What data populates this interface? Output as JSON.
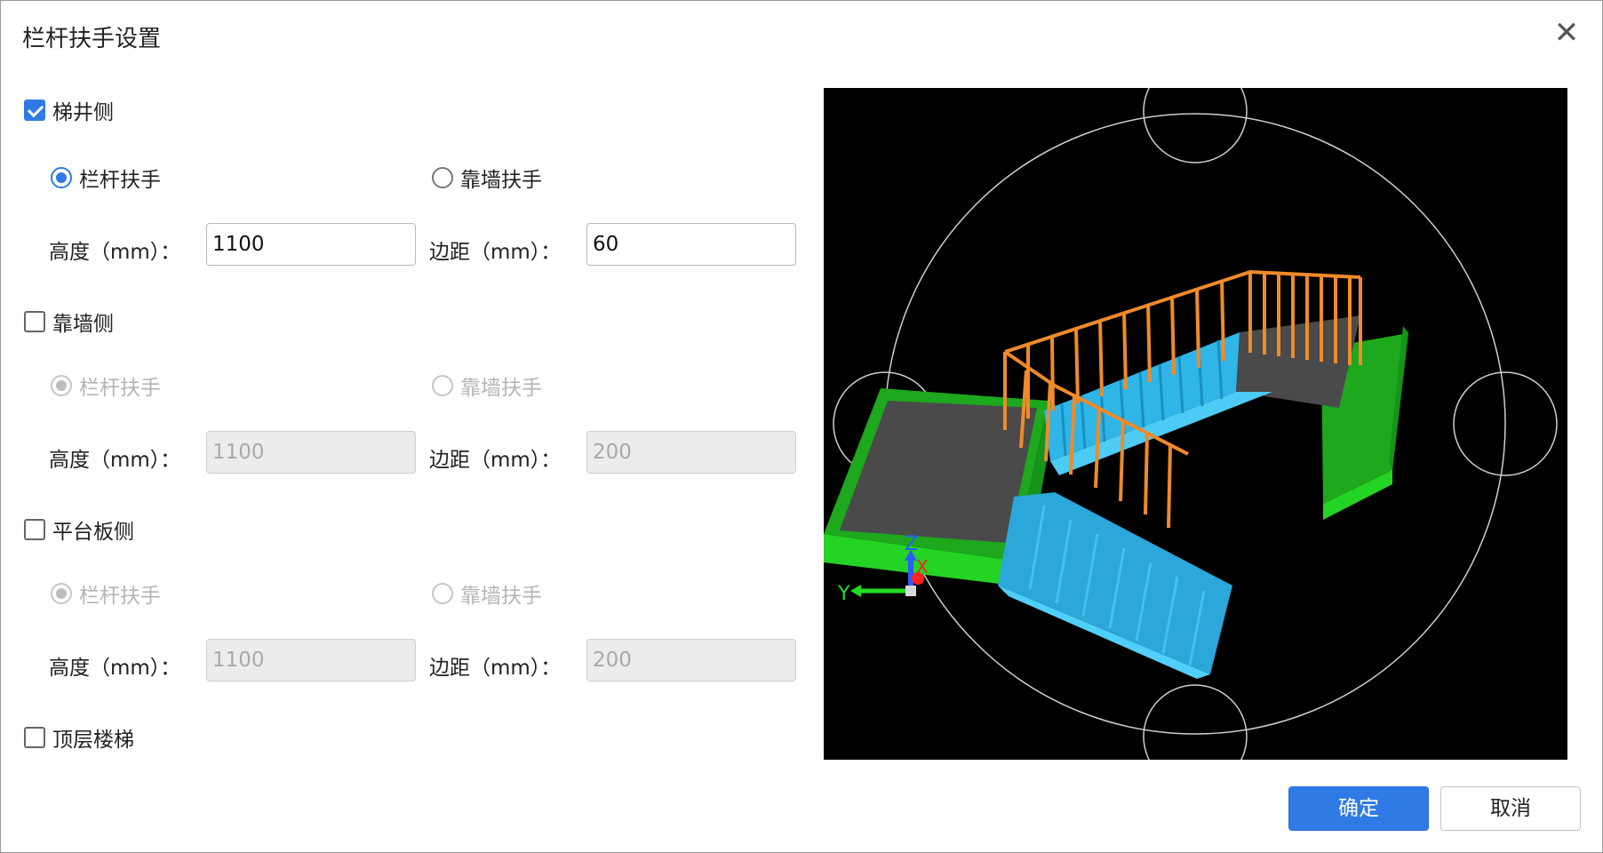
{
  "dialog": {
    "title": "栏杆扶手设置",
    "close_glyph": "✕"
  },
  "sections": [
    {
      "check_label": "梯井侧",
      "checked": true,
      "radio_railing": "栏杆扶手",
      "radio_wall": "靠墙扶手",
      "selected": "railing",
      "height_label": "高度（mm）：",
      "height_value": "1100",
      "margin_label": "边距（mm）：",
      "margin_value": "60"
    },
    {
      "check_label": "靠墙侧",
      "checked": false,
      "radio_railing": "栏杆扶手",
      "radio_wall": "靠墙扶手",
      "selected": "railing",
      "height_label": "高度（mm）：",
      "height_value": "1100",
      "margin_label": "边距（mm）：",
      "margin_value": "200"
    },
    {
      "check_label": "平台板侧",
      "checked": false,
      "radio_railing": "栏杆扶手",
      "radio_wall": "靠墙扶手",
      "selected": "railing",
      "height_label": "高度（mm）：",
      "height_value": "1100",
      "margin_label": "边距（mm）：",
      "margin_value": "200"
    }
  ],
  "top_floor": {
    "label": "顶层楼梯",
    "checked": false
  },
  "preview": {
    "axis_x": "X",
    "axis_y": "Y",
    "axis_z": "Z",
    "colors": {
      "background": "#000000",
      "platform": "#22cc22",
      "stairs": "#33bbee",
      "railing": "#f08a2a",
      "slab": "#4a4a4a"
    }
  },
  "buttons": {
    "ok": "确定",
    "cancel": "取消"
  },
  "accent_color": "#2f7ae5"
}
